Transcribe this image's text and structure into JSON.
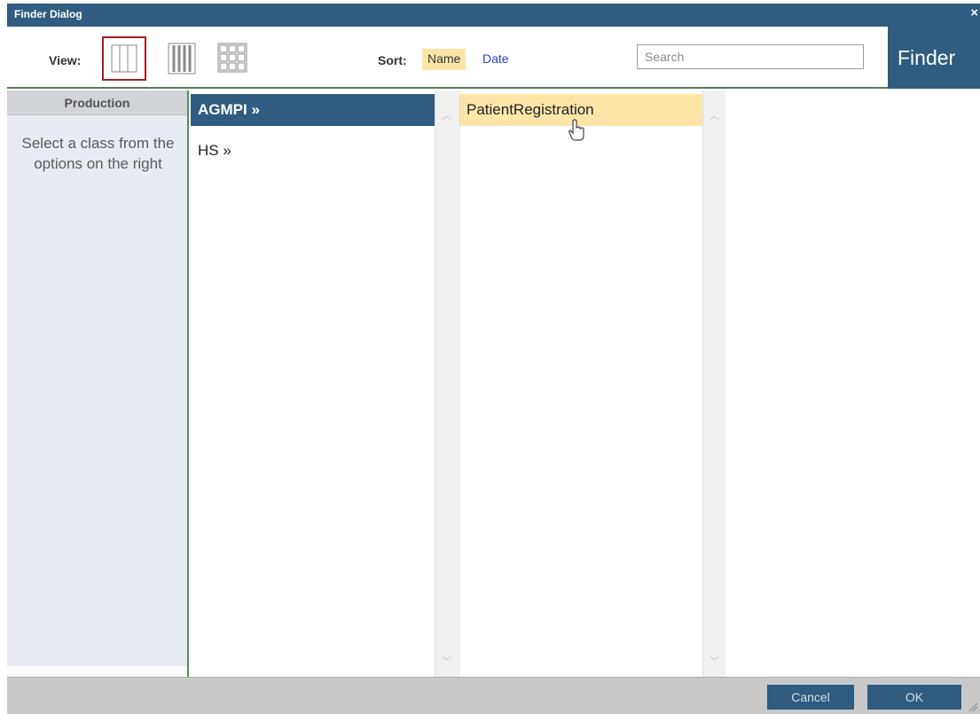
{
  "window": {
    "title": "Finder Dialog",
    "close_glyph": "×"
  },
  "toolbar": {
    "view_label": "View:",
    "view_modes": [
      "columns-view-icon",
      "list-view-icon",
      "grid-view-icon"
    ],
    "selected_view": "columns-view-icon",
    "sort_label": "Sort:",
    "sort_name": "Name",
    "sort_date": "Date",
    "search_placeholder": "Search",
    "brand": "Finder"
  },
  "sidebar": {
    "header": "Production",
    "message": "Select a class from the options on the right"
  },
  "columns": {
    "col1": [
      {
        "label": "AGMPI »",
        "state": "active"
      },
      {
        "label": "HS »",
        "state": "normal"
      }
    ],
    "col2": [
      {
        "label": "PatientRegistration",
        "state": "hover"
      }
    ]
  },
  "buttons": {
    "cancel": "Cancel",
    "ok": "OK"
  },
  "colors": {
    "accent": "#2f5c80",
    "selected_border": "#a31e1e",
    "hover_highlight": "#fbe6a8",
    "link": "#2b3fbf"
  }
}
